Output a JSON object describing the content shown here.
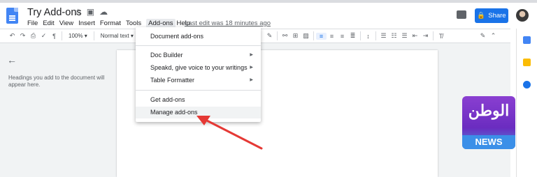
{
  "document": {
    "title": "Try Add-ons",
    "last_edit": "Last edit was 18 minutes ago"
  },
  "menubar": [
    "File",
    "Edit",
    "View",
    "Insert",
    "Format",
    "Tools",
    "Add-ons",
    "Help"
  ],
  "active_menu": "Add-ons",
  "share": {
    "label": "Share"
  },
  "toolbar": {
    "zoom": "100%",
    "style": "Normal text"
  },
  "outline": {
    "placeholder": "Headings you add to the document will appear here."
  },
  "addons_menu": {
    "items": [
      {
        "label": "Document add-ons",
        "submenu": false
      },
      {
        "label": "Doc Builder",
        "submenu": true
      },
      {
        "label": "Speakd, give voice to your writings",
        "submenu": true
      },
      {
        "label": "Table Formatter",
        "submenu": true
      },
      {
        "label": "Get add-ons",
        "submenu": false
      },
      {
        "label": "Manage add-ons",
        "submenu": false,
        "highlighted": true
      }
    ]
  },
  "watermark": {
    "arabic": "الوطن",
    "label": "NEWS"
  },
  "colors": {
    "share_button": "#1a73e8",
    "annotation_arrow": "#e53935",
    "doc_icon": "#4285f4"
  },
  "icons": [
    "docs-logo-icon",
    "star-icon",
    "folder-icon",
    "cloud-icon",
    "comment-icon",
    "lock-icon",
    "avatar",
    "back-arrow-icon"
  ]
}
